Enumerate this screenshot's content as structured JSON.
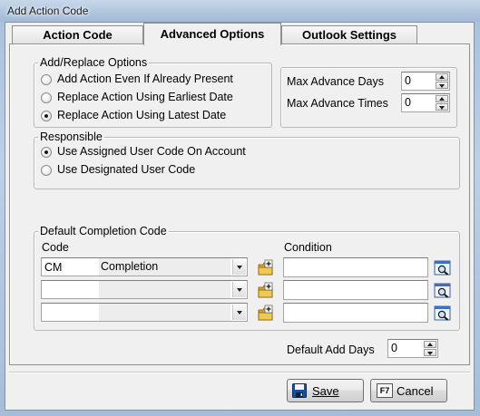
{
  "window": {
    "title": "Add Action Code"
  },
  "tabs": [
    {
      "label": "Action Code",
      "active": false
    },
    {
      "label": "Advanced Options",
      "active": true
    },
    {
      "label": "Outlook Settings",
      "active": false
    }
  ],
  "add_replace": {
    "legend": "Add/Replace Options",
    "options": [
      {
        "label": "Add Action Even If Already Present",
        "checked": false
      },
      {
        "label": "Replace Action Using Earliest Date",
        "checked": false
      },
      {
        "label": "Replace Action Using Latest Date",
        "checked": true
      }
    ]
  },
  "advance": {
    "max_days_label": "Max Advance Days",
    "max_days_value": "0",
    "max_times_label": "Max Advance Times",
    "max_times_value": "0"
  },
  "responsible": {
    "legend": "Responsible",
    "options": [
      {
        "label": "Use Assigned User Code On Account",
        "checked": true
      },
      {
        "label": "Use Designated User Code",
        "checked": false
      }
    ]
  },
  "completion": {
    "legend": "Default Completion Code",
    "code_header": "Code",
    "condition_header": "Condition",
    "rows": [
      {
        "code": "CM",
        "description": "Completion",
        "condition": ""
      },
      {
        "code": "",
        "description": "",
        "condition": ""
      },
      {
        "code": "",
        "description": "",
        "condition": ""
      }
    ]
  },
  "default_add_days": {
    "label": "Default Add Days",
    "value": "0"
  },
  "buttons": {
    "save_label": "Save",
    "cancel_key": "F7",
    "cancel_label": "Cancel"
  },
  "colors": {
    "titlebar": "#aec4dd",
    "dialog_bg": "#f0f0f0",
    "save_icon": "#1a4f9c"
  }
}
